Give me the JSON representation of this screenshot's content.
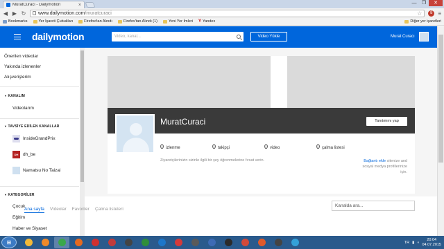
{
  "browser": {
    "tab_title": "MuratCuraci - Dailymotion",
    "tab_close": "×",
    "url_host": "www.dailymotion.com",
    "url_path": "/muratcuraci",
    "win_min": "—",
    "win_max": "❐",
    "win_close": "✕",
    "back": "◀",
    "forward": "▶",
    "reload": "↻",
    "star": "☆",
    "menu": "≡",
    "ext_badge": "8"
  },
  "bookmarks": {
    "items": [
      {
        "label": "Bookmarks",
        "icon": "apps"
      },
      {
        "label": "Yer İşareti Çubukları",
        "icon": "folder"
      },
      {
        "label": "Firefox'tan Alındı",
        "icon": "folder"
      },
      {
        "label": "Firefox'tan Alındı (1)",
        "icon": "folder"
      },
      {
        "label": "Yeni Yer İmleri",
        "icon": "folder"
      },
      {
        "label": "Yandex",
        "icon": "yandex"
      }
    ],
    "other": "Diğer yer işaretleri"
  },
  "header": {
    "logo": "dailymotion",
    "search_placeholder": "Video, kanal...",
    "upload_label": "Video Yükle",
    "username": "Murat Curacı"
  },
  "sidebar": {
    "links": [
      "Önerilen videolar",
      "Yakında izlenenler",
      "Alışverişlerim"
    ],
    "section_channel": "KANALIM",
    "channel_link": "Videolarım",
    "section_recommended": "TAVSİYE EDİLEN KANALLAR",
    "channels": [
      "InsideGrandPrix",
      "dh_be",
      "Namatsu No Taizai"
    ],
    "section_categories": "KATEGORİLER",
    "categories": [
      "Çocuk",
      "Eğitim",
      "Haber ve Siyaset"
    ]
  },
  "profile": {
    "name": "MuratCuraci",
    "promote_btn": "Tanıtımını yap",
    "stats": [
      {
        "num": "0",
        "label": "izlenme"
      },
      {
        "num": "0",
        "label": "takipçi"
      },
      {
        "num": "0",
        "label": "video"
      },
      {
        "num": "0",
        "label": "çalma listesi"
      }
    ],
    "message": "Ziyaretçilerinizin sizinle ilgili bir şey öğrenmelerine fırsat verin.",
    "side_link": "Bağlantı ekle",
    "side_text": "sitenize and sosyal medya profillerinize için."
  },
  "tabs": [
    "Ana sayfa",
    "Videolar",
    "Favoriler",
    "Çalma listeleri"
  ],
  "channel_search": "Kanalda ara...",
  "taskbar": {
    "start": "⊞",
    "time": "20:04",
    "date": "04.07.2015",
    "lang": "TR",
    "apps": [
      {
        "color": "#f3b938"
      },
      {
        "color": "#f08a2a"
      },
      {
        "color": "#3aa84a"
      },
      {
        "color": "#e66a1f"
      },
      {
        "color": "#d03030"
      },
      {
        "color": "#c23b3b"
      },
      {
        "color": "#444444"
      },
      {
        "color": "#2f8f3a"
      },
      {
        "color": "#1c76c9"
      },
      {
        "color": "#d53a3a"
      },
      {
        "color": "#5a5a5a"
      },
      {
        "color": "#3d6bb5"
      },
      {
        "color": "#2b2b2b"
      },
      {
        "color": "#d24a3a"
      },
      {
        "color": "#e05a2a"
      },
      {
        "color": "#444444"
      },
      {
        "color": "#34a0d8"
      }
    ]
  }
}
